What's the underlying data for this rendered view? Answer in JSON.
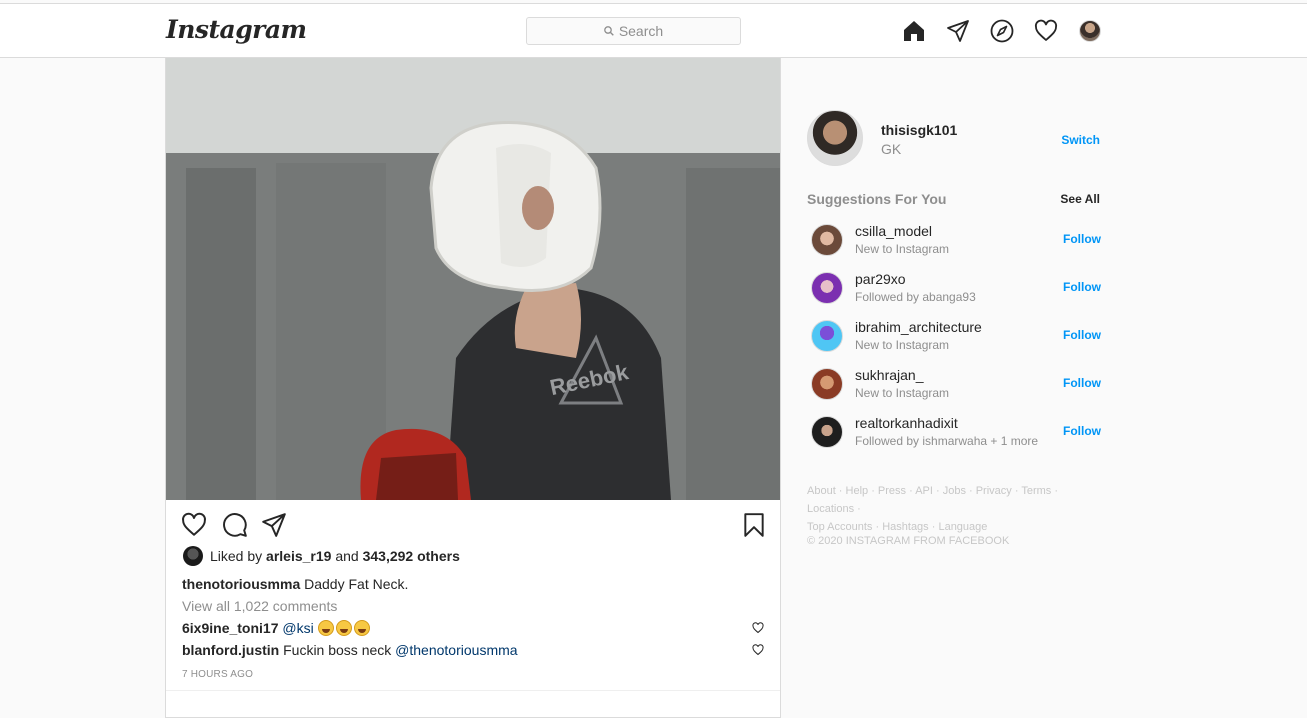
{
  "header": {
    "logo": "Instagram",
    "search_placeholder": "Search"
  },
  "post": {
    "liked_by_prefix": "Liked by",
    "liked_by_user": "arleis_r19",
    "liked_by_mid": "and",
    "liked_by_count": "343,292 others",
    "caption_user": "thenotoriousmma",
    "caption_text": "Daddy Fat Neck.",
    "view_all": "View all 1,022 comments",
    "comments": [
      {
        "user": "6ix9ine_toni17",
        "mention": "@ksi",
        "text": ""
      },
      {
        "user": "blanford.justin",
        "text": "Fuckin boss neck",
        "mention": "@thenotoriousmma"
      }
    ],
    "time": "7 HOURS AGO"
  },
  "sidebar": {
    "username": "thisisgk101",
    "fullname": "GK",
    "switch": "Switch",
    "suggestions_title": "Suggestions For You",
    "see_all": "See All",
    "suggestions": [
      {
        "user": "csilla_model",
        "sub": "New to Instagram",
        "action": "Follow",
        "color": "#c9a08c"
      },
      {
        "user": "par29xo",
        "sub": "Followed by abanga93",
        "action": "Follow",
        "color": "#b04fd8"
      },
      {
        "user": "ibrahim_architecture",
        "sub": "New to Instagram",
        "action": "Follow",
        "color": "#4fb8f0"
      },
      {
        "user": "sukhrajan_",
        "sub": "New to Instagram",
        "action": "Follow",
        "color": "#c0674a"
      },
      {
        "user": "realtorkanhadixit",
        "sub": "Followed by ishmarwaha + 1 more",
        "action": "Follow",
        "color": "#3b3b3b"
      }
    ],
    "footer_line1": "About · Help · Press · API · Jobs · Privacy · Terms · Locations ·",
    "footer_line2": "Top Accounts · Hashtags · Language",
    "copyright": "© 2020 INSTAGRAM FROM FACEBOOK"
  }
}
